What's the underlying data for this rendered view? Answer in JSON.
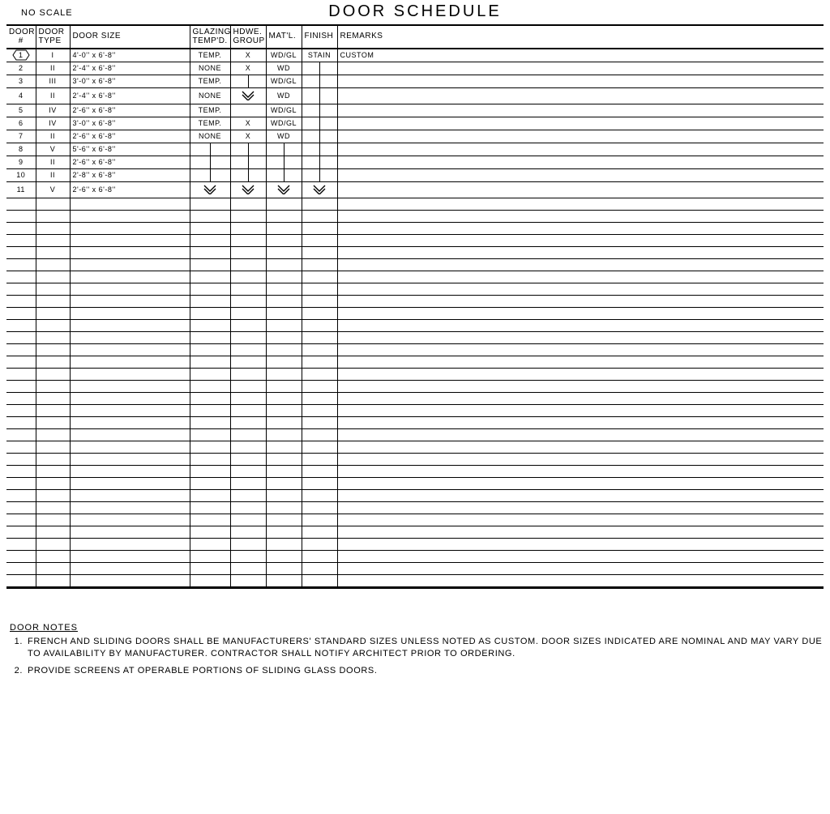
{
  "header": {
    "no_scale": "NO SCALE",
    "title": "DOOR SCHEDULE"
  },
  "columns": {
    "door_num": {
      "line1": "DOOR",
      "line2": "#"
    },
    "door_type": {
      "line1": "DOOR",
      "line2": "TYPE"
    },
    "door_size": {
      "line1": "DOOR SIZE"
    },
    "glazing": {
      "line1": "GLAZING",
      "line2": "TEMP'D."
    },
    "hdwe": {
      "line1": "HDWE.",
      "line2": "GROUP"
    },
    "matl": {
      "line1": "MAT'L."
    },
    "finish": {
      "line1": "FINISH"
    },
    "remarks": {
      "line1": "REMARKS"
    }
  },
  "rows": [
    {
      "num": "1",
      "num_hex": true,
      "type": "I",
      "size": "4'-0'' x 6'-8''",
      "glaz": "TEMP.",
      "hdwe": "X",
      "matl": "WD/GL",
      "fin": "STAIN",
      "rem": "CUSTOM"
    },
    {
      "num": "2",
      "type": "II",
      "size": "2'-4'' x 6'-8''",
      "glaz": "NONE",
      "hdwe": "X",
      "matl": "WD",
      "fin_cont": true
    },
    {
      "num": "3",
      "type": "III",
      "size": "3'-0'' x 6'-8''",
      "glaz": "TEMP.",
      "hdwe_cont": true,
      "matl": "WD/GL",
      "fin_cont": true
    },
    {
      "num": "4",
      "type": "II",
      "size": "2'-4'' x 6'-8''",
      "glaz": "NONE",
      "hdwe_arrow": true,
      "matl": "WD",
      "fin_cont": true
    },
    {
      "num": "5",
      "type": "IV",
      "size": "2'-6'' x 6'-8''",
      "glaz": "TEMP.",
      "matl": "WD/GL",
      "fin_cont": true
    },
    {
      "num": "6",
      "type": "IV",
      "size": "3'-0'' x 6'-8''",
      "glaz": "TEMP.",
      "hdwe": "X",
      "matl": "WD/GL",
      "fin_cont": true
    },
    {
      "num": "7",
      "type": "II",
      "size": "2'-6'' x 6'-8''",
      "glaz": "NONE",
      "hdwe": "X",
      "matl": "WD",
      "fin_cont": true
    },
    {
      "num": "8",
      "type": "V",
      "size": "5'-6'' x 6'-8''",
      "glaz_cont": true,
      "hdwe_cont": true,
      "matl_cont": true,
      "fin_cont": true
    },
    {
      "num": "9",
      "type": "II",
      "size": "2'-6'' x 6'-8''",
      "glaz_cont": true,
      "hdwe_cont": true,
      "matl_cont": true,
      "fin_cont": true
    },
    {
      "num": "10",
      "type": "II",
      "size": "2'-8'' x 6'-8''",
      "glaz_cont": true,
      "hdwe_cont": true,
      "matl_cont": true,
      "fin_cont": true
    },
    {
      "num": "11",
      "type": "V",
      "size": "2'-6'' x 6'-8''",
      "glaz_arrow": true,
      "hdwe_arrow": true,
      "matl_arrow": true,
      "fin_arrow": true
    }
  ],
  "blank_row_count": 32,
  "notes": {
    "title": "DOOR NOTES",
    "items": [
      {
        "num": "1.",
        "text": "FRENCH AND SLIDING DOORS SHALL BE MANUFACTURERS' STANDARD SIZES UNLESS NOTED AS CUSTOM. DOOR SIZES INDICATED ARE NOMINAL AND MAY VARY DUE TO AVAILABILITY BY MANUFACTURER.  CONTRACTOR SHALL NOTIFY ARCHITECT PRIOR TO ORDERING."
      },
      {
        "num": "2.",
        "text": "PROVIDE SCREENS AT OPERABLE PORTIONS OF SLIDING GLASS DOORS."
      }
    ]
  }
}
